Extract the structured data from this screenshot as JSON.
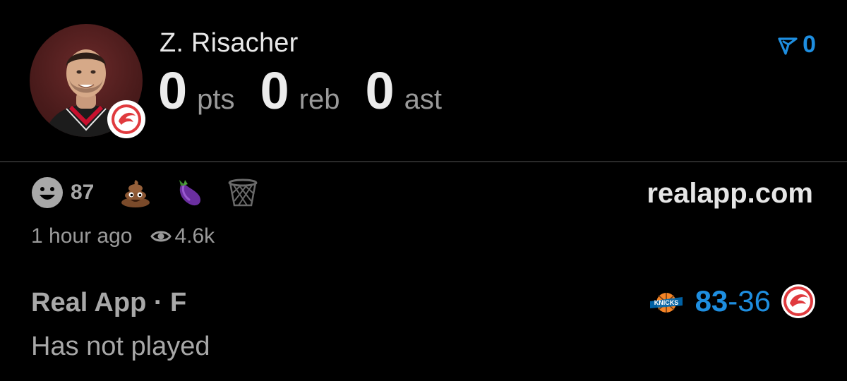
{
  "player": {
    "name": "Z. Risacher",
    "team_logo": "atlanta-hawks-logo",
    "avatar": "player-headshot"
  },
  "stats": [
    {
      "value": "0",
      "unit": "pts"
    },
    {
      "value": "0",
      "unit": "reb"
    },
    {
      "value": "0",
      "unit": "ast"
    }
  ],
  "vote": {
    "icon": "upvote-icon",
    "count": "0",
    "color": "#1e8ee0"
  },
  "reactions": {
    "smiley_count": "87",
    "emojis": [
      "poop-emoji",
      "eggplant-emoji",
      "basketball-net-emoji"
    ]
  },
  "site": "realapp.com",
  "meta": {
    "time": "1 hour ago",
    "views": "4.6k"
  },
  "source": {
    "label": "Real App · F",
    "status": "Has not played"
  },
  "game": {
    "left_team": "new-york-knicks-logo",
    "left_score": "83",
    "separator": "-",
    "right_score": "36",
    "right_team": "atlanta-hawks-logo"
  },
  "colors": {
    "background": "#000000",
    "accent": "#1e8ee0",
    "hawks_red": "#e03a3e"
  }
}
